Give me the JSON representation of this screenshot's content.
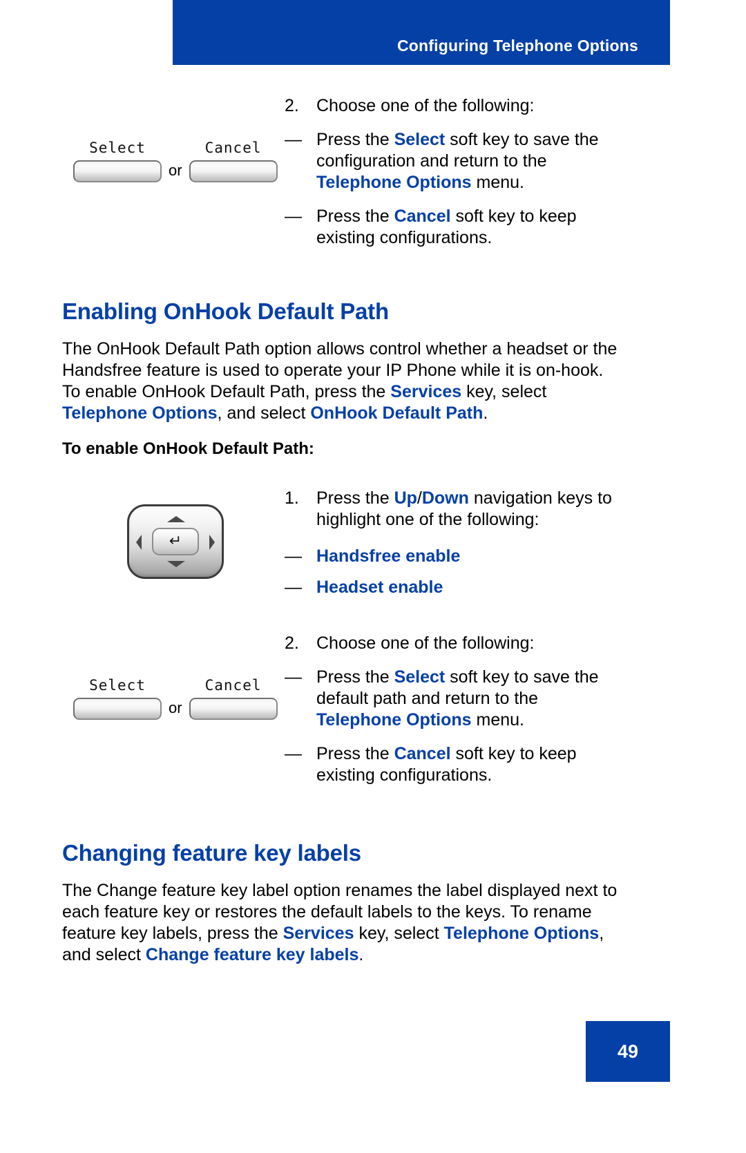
{
  "header": {
    "title": "Configuring Telephone Options",
    "banner_color": "#0540a6"
  },
  "colors": {
    "accent_blue": "#0540a6",
    "text_black": "#000000",
    "page_background": "#ffffff"
  },
  "top_step": {
    "number": "2.",
    "text": "Choose one of the following:",
    "bullets": [
      {
        "dash": "—",
        "parts": [
          {
            "text": "Press the ",
            "style": "plain"
          },
          {
            "text": "Select",
            "style": "blue-bold"
          },
          {
            "text": " soft key to save the configuration and return to the ",
            "style": "plain"
          },
          {
            "text": "Telephone Options",
            "style": "blue-bold"
          },
          {
            "text": " menu.",
            "style": "plain"
          }
        ],
        "line1": "Press the Select soft key to save the",
        "line2": "configuration and return to the",
        "line3": "Telephone Options menu."
      },
      {
        "dash": "—",
        "line1": "Press the Cancel soft key to keep",
        "line2": "existing configurations."
      }
    ],
    "softkeys": {
      "select_label": "Select",
      "or_label": "or",
      "cancel_label": "Cancel"
    }
  },
  "section_onhook": {
    "heading": "Enabling OnHook Default Path",
    "paragraph": {
      "line1_a": "The OnHook Default Path option allows control whether a headset or the",
      "line2_a": "Handsfree feature is used to operate your IP Phone while it is on-hook.",
      "line3_a": "To enable OnHook Default Path, press the ",
      "line3_services": "Services",
      "line3_b": " key, select",
      "line4_telephone_options": "Telephone Options",
      "line4_a": ", and select ",
      "line4_onhook": "OnHook Default Path",
      "line4_b": "."
    },
    "subheading": "To enable OnHook Default Path:",
    "step1": {
      "number": "1.",
      "line1_a": "Press the ",
      "line1_up": "Up",
      "line1_slash": "/",
      "line1_down": "Down",
      "line1_b": " navigation keys to",
      "line2": "highlight one of the following:",
      "options": [
        {
          "dash": "—",
          "label": "Handsfree enable"
        },
        {
          "dash": "—",
          "label": "Headset enable"
        }
      ]
    },
    "step2": {
      "number": "2.",
      "text": "Choose one of the following:",
      "bullets": [
        {
          "dash": "—",
          "line1": "Press the Select soft key to save the",
          "line2": "default path and return to the",
          "line3": "Telephone Options menu."
        },
        {
          "dash": "—",
          "line1": "Press the Cancel soft key to keep",
          "line2": "existing configurations."
        }
      ],
      "softkeys": {
        "select_label": "Select",
        "or_label": "or",
        "cancel_label": "Cancel"
      }
    },
    "navkey_icon": {
      "up": "up-arrow",
      "down": "down-arrow",
      "left": "left-arrow",
      "right": "right-arrow",
      "center": "enter-key",
      "center_glyph": "↵"
    }
  },
  "section_featurekey": {
    "heading": "Changing feature key labels",
    "paragraph": {
      "line1": "The Change feature key label option renames the label displayed next to",
      "line2": "each feature key or restores the default labels to the keys. To rename",
      "line3_a": "feature key labels, press the ",
      "line3_services": "Services",
      "line3_b": " key, select ",
      "line3_telephone_options": "Telephone Options",
      "line3_c": ",",
      "line4_a": "and select ",
      "line4_change": "Change feature key labels",
      "line4_b": "."
    }
  },
  "footer": {
    "page_number": "49"
  }
}
